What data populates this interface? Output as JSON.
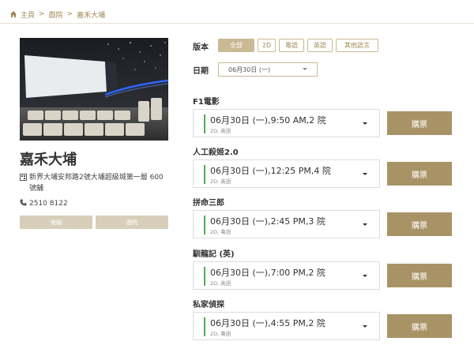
{
  "breadcrumb": {
    "home": "主頁",
    "section": "戲院",
    "current": "嘉禾大埔",
    "separator": ">"
  },
  "cinema": {
    "name": "嘉禾大埔",
    "address": "新界大埔安邦路2號大埔超級城第一層 600號舖",
    "phone": "2510 8122",
    "map_label": "地圖",
    "cinema_label": "戲院"
  },
  "filters": {
    "version_label": "版本",
    "versions": [
      "全部",
      "2D",
      "粵語",
      "英語",
      "其他語言"
    ],
    "active_version": "全部",
    "date_label": "日期",
    "date_value": "06月30日 (一)"
  },
  "movies": [
    {
      "title": "F1電影",
      "session": "06月30日 (一),9:50 AM,2 院",
      "format": "2D, 英語",
      "buy": "購票"
    },
    {
      "title": "人工殺姬2.0",
      "session": "06月30日 (一),12:25 PM,4 院",
      "format": "2D, 英語",
      "buy": "購票"
    },
    {
      "title": "拼命三郎",
      "session": "06月30日 (一),2:45 PM,3 院",
      "format": "2D, 粵語",
      "buy": "購票"
    },
    {
      "title": "馴龍記 (英)",
      "session": "06月30日 (一),7:00 PM,2 院",
      "format": "2D, 英語",
      "buy": "購票"
    },
    {
      "title": "私家偵探",
      "session": "06月30日 (一),4:55 PM,2 院",
      "format": "2D, 粵語",
      "buy": "購票"
    }
  ],
  "colors": {
    "accent": "#a89366",
    "pill_border": "#c9b994",
    "session_bar": "#4caf50",
    "side_button": "#d8cfba"
  },
  "icons": {
    "home": "home-icon",
    "address": "location-icon",
    "phone": "phone-icon",
    "dropdown": "chevron-down-icon"
  }
}
